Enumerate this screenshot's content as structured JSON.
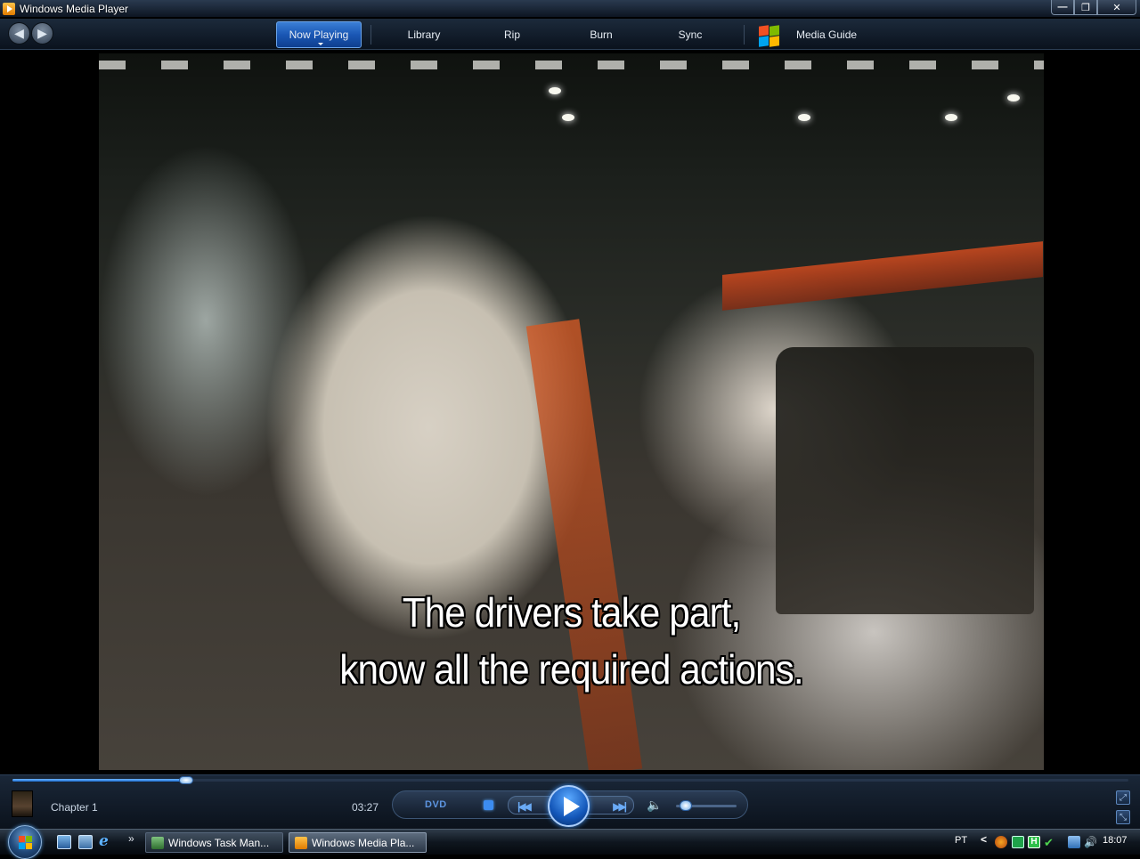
{
  "window": {
    "title": "Windows Media Player",
    "buttons": {
      "minimize": "—",
      "restore": "❐",
      "close": "✕"
    }
  },
  "nav": {
    "back_icon": "◀",
    "forward_icon": "▶",
    "tabs": {
      "now_playing": "Now Playing",
      "library": "Library",
      "rip": "Rip",
      "burn": "Burn",
      "sync": "Sync",
      "media_guide": "Media Guide"
    }
  },
  "video": {
    "subtitle_line1": "The drivers take part,",
    "subtitle_line2": "know all the required actions."
  },
  "controls": {
    "chapter": "Chapter 1",
    "time": "03:27",
    "dvd_label": "DVD",
    "seek_progress": 0.156,
    "volume_level": 0.1,
    "prev_icon": "|◀◀",
    "next_icon": "▶▶|",
    "mute_icon": "🔈",
    "view_top_icon": "⤢",
    "view_bottom_icon": "⤡",
    "accent_color": "#3c8cf0"
  },
  "taskbar": {
    "chevron": "»",
    "tasks": [
      {
        "label": "Windows Task Man..."
      },
      {
        "label": "Windows Media Pla..."
      }
    ],
    "tray": {
      "language": "PT",
      "chevron": "<",
      "clock": "18:07"
    }
  }
}
